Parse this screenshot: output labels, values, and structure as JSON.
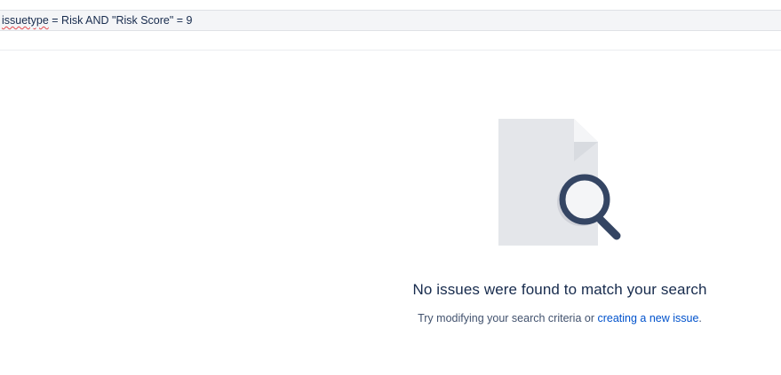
{
  "query": {
    "keyword": "issuetype",
    "rest": " = Risk AND \"Risk Score\" = 9"
  },
  "empty_state": {
    "icon": "document-search-icon",
    "title": "No issues were found to match your search",
    "description_prefix": "Try modifying your search criteria or ",
    "link_label": "creating a new issue",
    "description_suffix": "."
  },
  "colors": {
    "link": "#0052cc",
    "text": "#172b4d",
    "doc": "#e4e6ea",
    "magnifier": "#344563"
  }
}
